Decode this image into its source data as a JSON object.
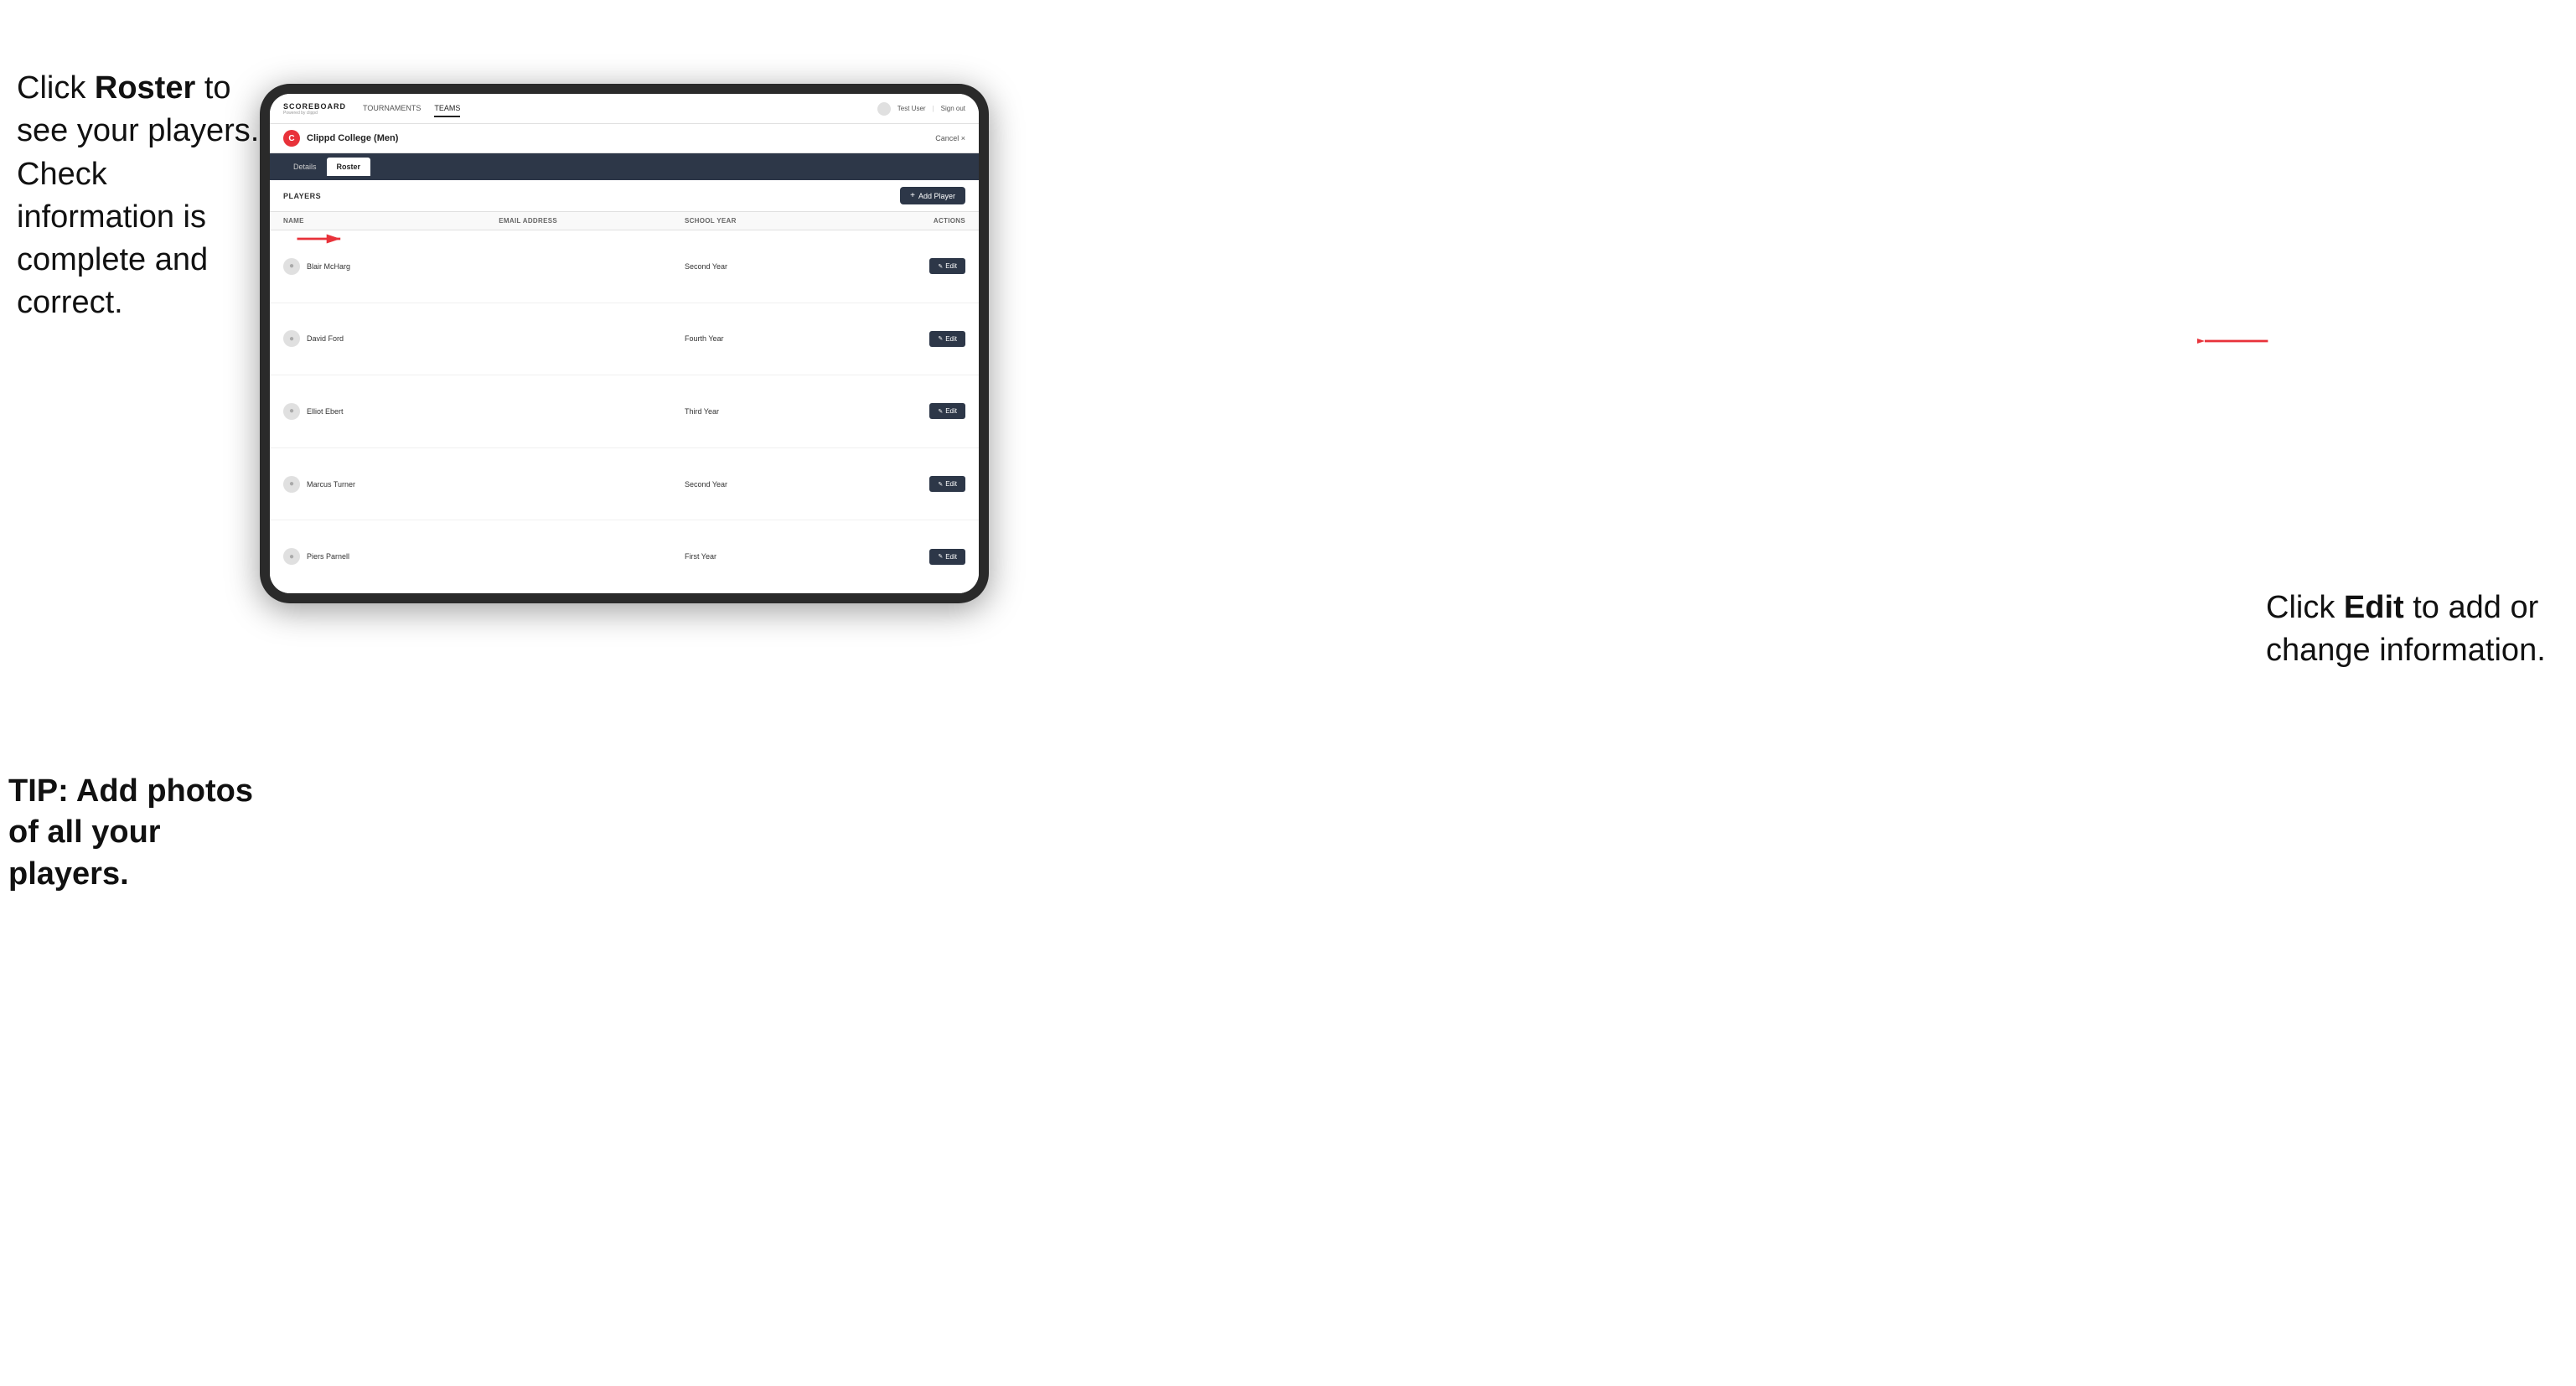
{
  "left_instructions": {
    "line1": "Click ",
    "bold1": "Roster",
    "line2": " to",
    "line3": "see your players.",
    "line4": "Check information",
    "line5": "is complete and",
    "line6": "correct."
  },
  "tip": {
    "text": "TIP: Add photos of all your players."
  },
  "right_instructions": {
    "line1": "Click ",
    "bold1": "Edit",
    "line2": " to add or change information."
  },
  "header": {
    "brand_name": "SCOREBOARD",
    "brand_sub": "Powered by clippd",
    "nav": [
      {
        "label": "TOURNAMENTS",
        "active": false
      },
      {
        "label": "TEAMS",
        "active": true
      }
    ],
    "user": "Test User",
    "separator": "|",
    "sign_out": "Sign out"
  },
  "team": {
    "icon_letter": "C",
    "name": "Clippd College (Men)",
    "cancel": "Cancel ×"
  },
  "tabs": [
    {
      "label": "Details",
      "active": false
    },
    {
      "label": "Roster",
      "active": true
    }
  ],
  "players_section": {
    "title": "PLAYERS",
    "add_button": "+ Add Player"
  },
  "table": {
    "columns": [
      {
        "key": "name",
        "label": "NAME"
      },
      {
        "key": "email",
        "label": "EMAIL ADDRESS"
      },
      {
        "key": "school_year",
        "label": "SCHOOL YEAR"
      },
      {
        "key": "actions",
        "label": "ACTIONS"
      }
    ],
    "rows": [
      {
        "name": "Blair McHarg",
        "email": "",
        "school_year": "Second Year"
      },
      {
        "name": "David Ford",
        "email": "",
        "school_year": "Fourth Year"
      },
      {
        "name": "Elliot Ebert",
        "email": "",
        "school_year": "Third Year"
      },
      {
        "name": "Marcus Turner",
        "email": "",
        "school_year": "Second Year"
      },
      {
        "name": "Piers Parnell",
        "email": "",
        "school_year": "First Year"
      }
    ],
    "edit_label": "Edit"
  }
}
